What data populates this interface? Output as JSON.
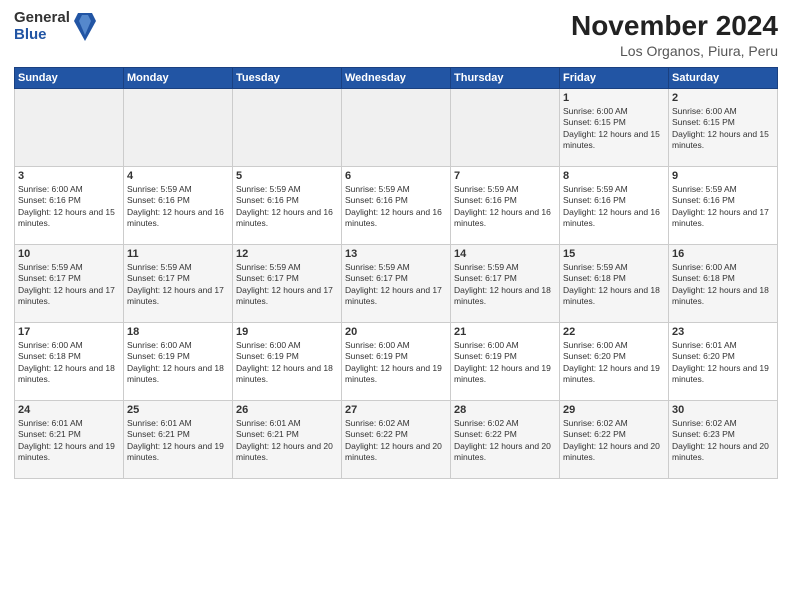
{
  "header": {
    "logo_general": "General",
    "logo_blue": "Blue",
    "title": "November 2024",
    "subtitle": "Los Organos, Piura, Peru"
  },
  "calendar": {
    "days_of_week": [
      "Sunday",
      "Monday",
      "Tuesday",
      "Wednesday",
      "Thursday",
      "Friday",
      "Saturday"
    ],
    "weeks": [
      [
        {
          "day": "",
          "content": ""
        },
        {
          "day": "",
          "content": ""
        },
        {
          "day": "",
          "content": ""
        },
        {
          "day": "",
          "content": ""
        },
        {
          "day": "",
          "content": ""
        },
        {
          "day": "1",
          "content": "Sunrise: 6:00 AM\nSunset: 6:15 PM\nDaylight: 12 hours and 15 minutes."
        },
        {
          "day": "2",
          "content": "Sunrise: 6:00 AM\nSunset: 6:15 PM\nDaylight: 12 hours and 15 minutes."
        }
      ],
      [
        {
          "day": "3",
          "content": "Sunrise: 6:00 AM\nSunset: 6:16 PM\nDaylight: 12 hours and 15 minutes."
        },
        {
          "day": "4",
          "content": "Sunrise: 5:59 AM\nSunset: 6:16 PM\nDaylight: 12 hours and 16 minutes."
        },
        {
          "day": "5",
          "content": "Sunrise: 5:59 AM\nSunset: 6:16 PM\nDaylight: 12 hours and 16 minutes."
        },
        {
          "day": "6",
          "content": "Sunrise: 5:59 AM\nSunset: 6:16 PM\nDaylight: 12 hours and 16 minutes."
        },
        {
          "day": "7",
          "content": "Sunrise: 5:59 AM\nSunset: 6:16 PM\nDaylight: 12 hours and 16 minutes."
        },
        {
          "day": "8",
          "content": "Sunrise: 5:59 AM\nSunset: 6:16 PM\nDaylight: 12 hours and 16 minutes."
        },
        {
          "day": "9",
          "content": "Sunrise: 5:59 AM\nSunset: 6:16 PM\nDaylight: 12 hours and 17 minutes."
        }
      ],
      [
        {
          "day": "10",
          "content": "Sunrise: 5:59 AM\nSunset: 6:17 PM\nDaylight: 12 hours and 17 minutes."
        },
        {
          "day": "11",
          "content": "Sunrise: 5:59 AM\nSunset: 6:17 PM\nDaylight: 12 hours and 17 minutes."
        },
        {
          "day": "12",
          "content": "Sunrise: 5:59 AM\nSunset: 6:17 PM\nDaylight: 12 hours and 17 minutes."
        },
        {
          "day": "13",
          "content": "Sunrise: 5:59 AM\nSunset: 6:17 PM\nDaylight: 12 hours and 17 minutes."
        },
        {
          "day": "14",
          "content": "Sunrise: 5:59 AM\nSunset: 6:17 PM\nDaylight: 12 hours and 18 minutes."
        },
        {
          "day": "15",
          "content": "Sunrise: 5:59 AM\nSunset: 6:18 PM\nDaylight: 12 hours and 18 minutes."
        },
        {
          "day": "16",
          "content": "Sunrise: 6:00 AM\nSunset: 6:18 PM\nDaylight: 12 hours and 18 minutes."
        }
      ],
      [
        {
          "day": "17",
          "content": "Sunrise: 6:00 AM\nSunset: 6:18 PM\nDaylight: 12 hours and 18 minutes."
        },
        {
          "day": "18",
          "content": "Sunrise: 6:00 AM\nSunset: 6:19 PM\nDaylight: 12 hours and 18 minutes."
        },
        {
          "day": "19",
          "content": "Sunrise: 6:00 AM\nSunset: 6:19 PM\nDaylight: 12 hours and 18 minutes."
        },
        {
          "day": "20",
          "content": "Sunrise: 6:00 AM\nSunset: 6:19 PM\nDaylight: 12 hours and 19 minutes."
        },
        {
          "day": "21",
          "content": "Sunrise: 6:00 AM\nSunset: 6:19 PM\nDaylight: 12 hours and 19 minutes."
        },
        {
          "day": "22",
          "content": "Sunrise: 6:00 AM\nSunset: 6:20 PM\nDaylight: 12 hours and 19 minutes."
        },
        {
          "day": "23",
          "content": "Sunrise: 6:01 AM\nSunset: 6:20 PM\nDaylight: 12 hours and 19 minutes."
        }
      ],
      [
        {
          "day": "24",
          "content": "Sunrise: 6:01 AM\nSunset: 6:21 PM\nDaylight: 12 hours and 19 minutes."
        },
        {
          "day": "25",
          "content": "Sunrise: 6:01 AM\nSunset: 6:21 PM\nDaylight: 12 hours and 19 minutes."
        },
        {
          "day": "26",
          "content": "Sunrise: 6:01 AM\nSunset: 6:21 PM\nDaylight: 12 hours and 20 minutes."
        },
        {
          "day": "27",
          "content": "Sunrise: 6:02 AM\nSunset: 6:22 PM\nDaylight: 12 hours and 20 minutes."
        },
        {
          "day": "28",
          "content": "Sunrise: 6:02 AM\nSunset: 6:22 PM\nDaylight: 12 hours and 20 minutes."
        },
        {
          "day": "29",
          "content": "Sunrise: 6:02 AM\nSunset: 6:22 PM\nDaylight: 12 hours and 20 minutes."
        },
        {
          "day": "30",
          "content": "Sunrise: 6:02 AM\nSunset: 6:23 PM\nDaylight: 12 hours and 20 minutes."
        }
      ]
    ]
  }
}
